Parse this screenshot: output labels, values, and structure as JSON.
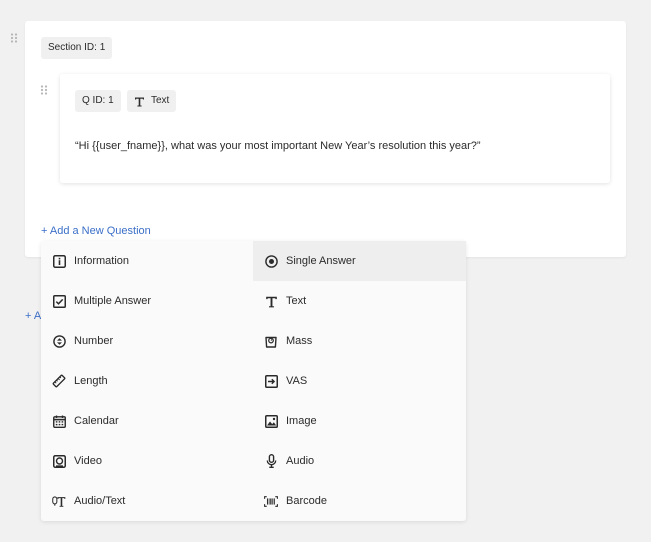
{
  "section": {
    "id_label": "Section ID: 1",
    "add_section_label": "+ A"
  },
  "question": {
    "id_label": "Q ID: 1",
    "type_label": "Text",
    "type_icon": "text-t-icon",
    "text": "“Hi {{user_fname}}, what was your most important New Year’s resolution this year?”"
  },
  "add_question_label": "+ Add a New Question",
  "question_types": [
    {
      "label": "Information",
      "icon": "info-icon"
    },
    {
      "label": "Single Answer",
      "icon": "radio-icon",
      "active": true
    },
    {
      "label": "Multiple Answer",
      "icon": "checkbox-icon"
    },
    {
      "label": "Text",
      "icon": "text-t-icon"
    },
    {
      "label": "Number",
      "icon": "number-stepper-icon"
    },
    {
      "label": "Mass",
      "icon": "scale-icon"
    },
    {
      "label": "Length",
      "icon": "ruler-icon"
    },
    {
      "label": "VAS",
      "icon": "arrow-box-icon"
    },
    {
      "label": "Calendar",
      "icon": "calendar-icon"
    },
    {
      "label": "Image",
      "icon": "image-icon"
    },
    {
      "label": "Video",
      "icon": "video-icon"
    },
    {
      "label": "Audio",
      "icon": "microphone-icon"
    },
    {
      "label": "Audio/Text",
      "icon": "audio-text-icon"
    },
    {
      "label": "Barcode",
      "icon": "barcode-icon"
    }
  ],
  "colors": {
    "link": "#3b6fc7",
    "background": "#f1f1f1",
    "active_item": "#eeeeee"
  }
}
